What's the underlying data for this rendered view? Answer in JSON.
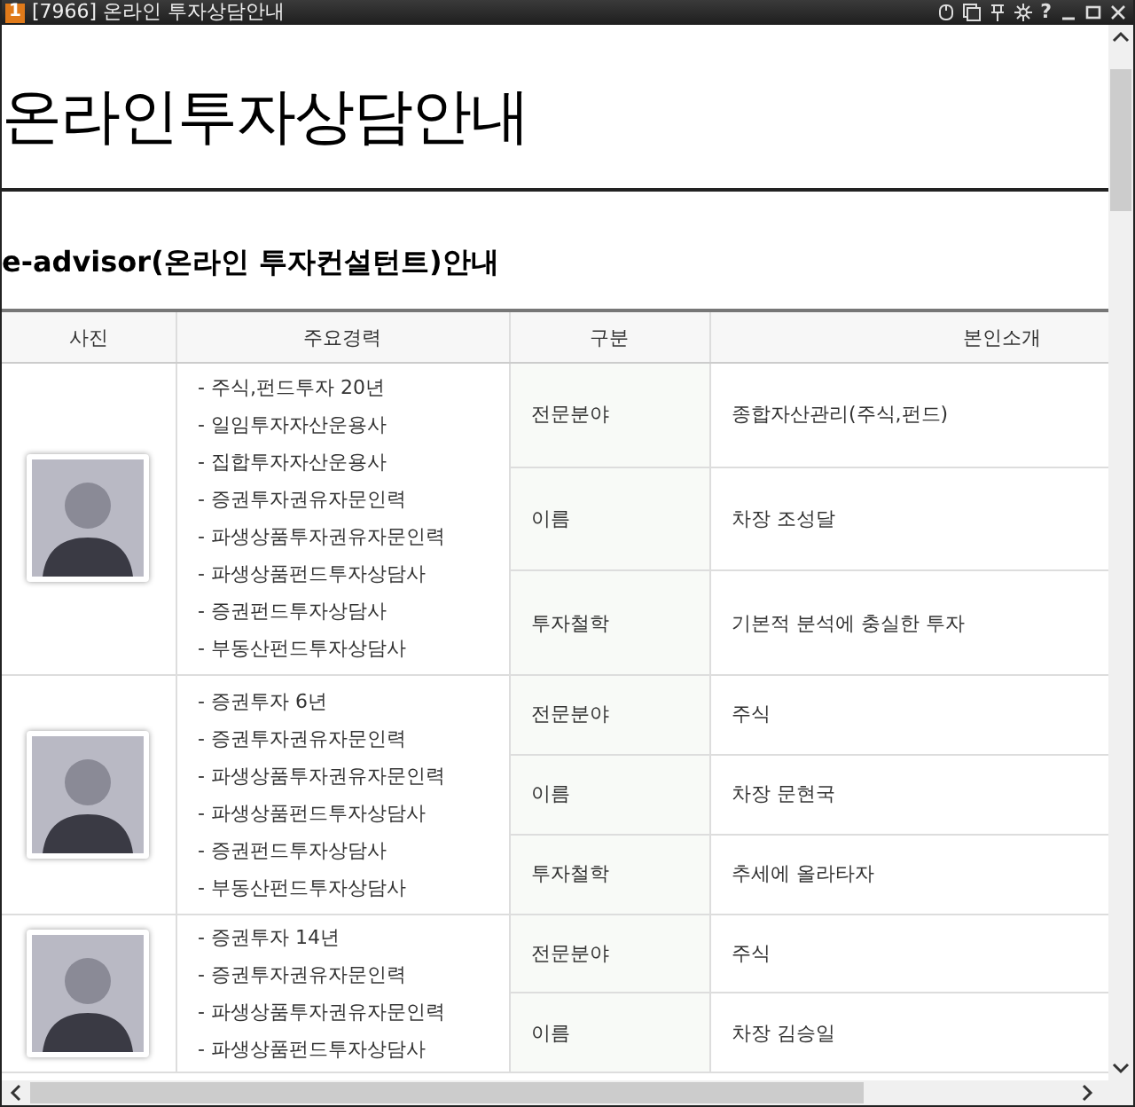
{
  "window": {
    "badge": "1",
    "title": "[7966] 온라인 투자상담안내",
    "help": "?"
  },
  "page_title": "온라인투자상담안내",
  "section_title": "e-advisor(온라인 투자컨설턴트)안내",
  "table": {
    "columns": [
      "사진",
      "주요경력",
      "구분",
      "본인소개"
    ],
    "rows": [
      {
        "career": [
          "- 주식,펀드투자 20년",
          "- 일임투자자산운용사",
          "- 집합투자자산운용사",
          "- 증권투자권유자문인력",
          "- 파생상품투자권유자문인력",
          "- 파생상품펀드투자상담사",
          "- 증권펀드투자상담사",
          "- 부동산펀드투자상담사"
        ],
        "details": [
          {
            "label": "전문분야",
            "value": "종합자산관리(주식,펀드)"
          },
          {
            "label": "이름",
            "value": "차장 조성달"
          },
          {
            "label": "투자철학",
            "value": "기본적 분석에 충실한 투자"
          }
        ]
      },
      {
        "career": [
          "- 증권투자 6년",
          "- 증권투자권유자문인력",
          "- 파생상품투자권유자문인력",
          "- 파생상품펀드투자상담사",
          "- 증권펀드투자상담사",
          "- 부동산펀드투자상담사"
        ],
        "details": [
          {
            "label": "전문분야",
            "value": "주식"
          },
          {
            "label": "이름",
            "value": "차장 문현국"
          },
          {
            "label": "투자철학",
            "value": "추세에 올라타자"
          }
        ]
      },
      {
        "career": [
          "- 증권투자 14년",
          "- 증권투자권유자문인력",
          "- 파생상품투자권유자문인력",
          "- 파생상품펀드투자상담사"
        ],
        "details": [
          {
            "label": "전문분야",
            "value": "주식"
          },
          {
            "label": "이름",
            "value": "차장 김승일"
          }
        ]
      }
    ]
  }
}
